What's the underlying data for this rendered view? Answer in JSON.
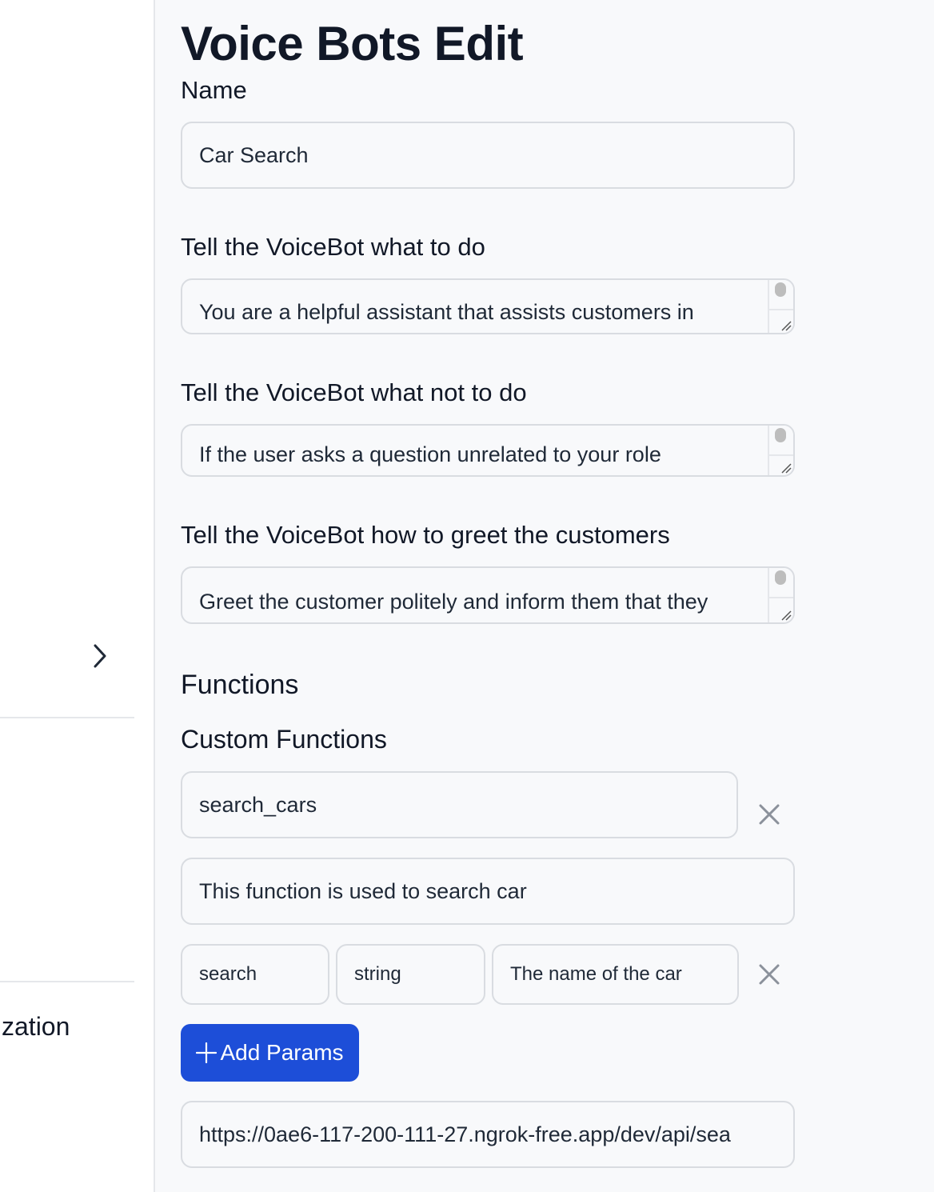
{
  "sidebar": {
    "partial_label": "zation"
  },
  "page": {
    "title": "Voice Bots Edit"
  },
  "form": {
    "name_label": "Name",
    "name_value": "Car Search",
    "do_label": "Tell the VoiceBot what to do",
    "do_value": "You are a helpful assistant that assists customers in",
    "not_do_label": "Tell the VoiceBot what not to do",
    "not_do_value": "If the user asks a question unrelated to your role",
    "greet_label": "Tell the VoiceBot how to greet the customers",
    "greet_value": "Greet the customer politely and inform them that they"
  },
  "functions": {
    "title": "Functions",
    "custom_title": "Custom Functions",
    "function_name": "search_cars",
    "function_description": "This function is used to search car",
    "params": [
      {
        "name": "search",
        "type": "string",
        "description": "The name of the car"
      }
    ],
    "add_params_label": "Add Params",
    "url": "https://0ae6-117-200-111-27.ngrok-free.app/dev/api/sea"
  },
  "colors": {
    "primary": "#1d4ed8",
    "border": "#d9dce1",
    "background": "#f8f9fb",
    "icon_gray": "#8b919b"
  }
}
